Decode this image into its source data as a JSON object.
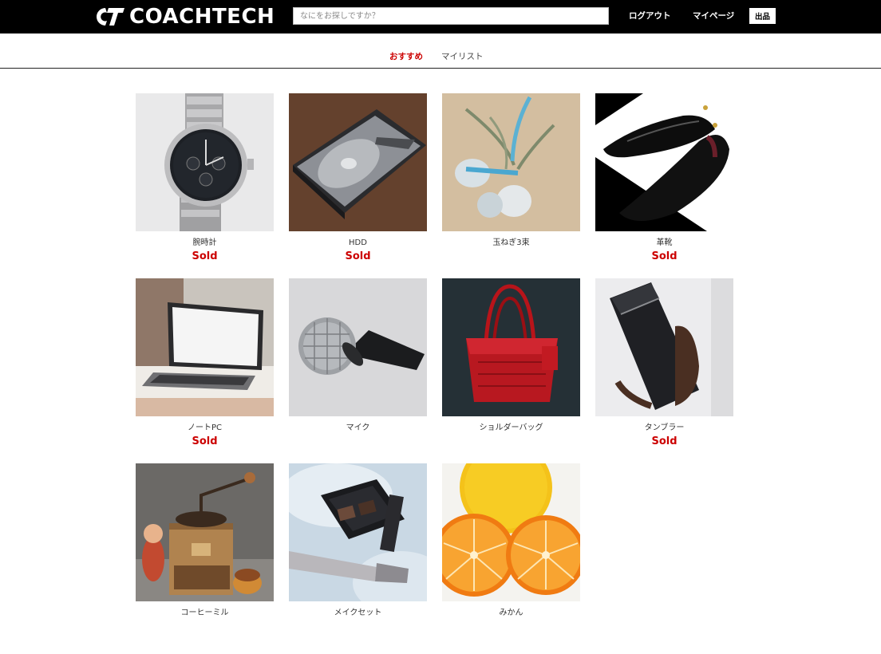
{
  "header": {
    "logo_text": "COACHTECH",
    "search_placeholder": "なにをお探しですか？",
    "logout_label": "ログアウト",
    "mypage_label": "マイページ",
    "sell_label": "出品"
  },
  "tabs": [
    {
      "label": "おすすめ",
      "active": true
    },
    {
      "label": "マイリスト",
      "active": false
    }
  ],
  "products": [
    {
      "name": "腕時計",
      "status": "Sold",
      "image": "wristwatch"
    },
    {
      "name": "HDD",
      "status": "Sold",
      "image": "hard-drive"
    },
    {
      "name": "玉ねぎ3束",
      "status": "",
      "image": "onions"
    },
    {
      "name": "革靴",
      "status": "Sold",
      "image": "leather-shoes"
    },
    {
      "name": "ノートPC",
      "status": "Sold",
      "image": "laptop"
    },
    {
      "name": "マイク",
      "status": "",
      "image": "microphone"
    },
    {
      "name": "ショルダーバッグ",
      "status": "",
      "image": "shoulder-bag"
    },
    {
      "name": "タンブラー",
      "status": "Sold",
      "image": "tumbler"
    },
    {
      "name": "コーヒーミル",
      "status": "",
      "image": "coffee-mill"
    },
    {
      "name": "メイクセット",
      "status": "",
      "image": "makeup-set"
    },
    {
      "name": "みかん",
      "status": "",
      "image": "mandarin-oranges"
    }
  ],
  "colors": {
    "header_bg": "#000000",
    "accent_red": "#cc0000",
    "tab_inactive": "#444444"
  }
}
